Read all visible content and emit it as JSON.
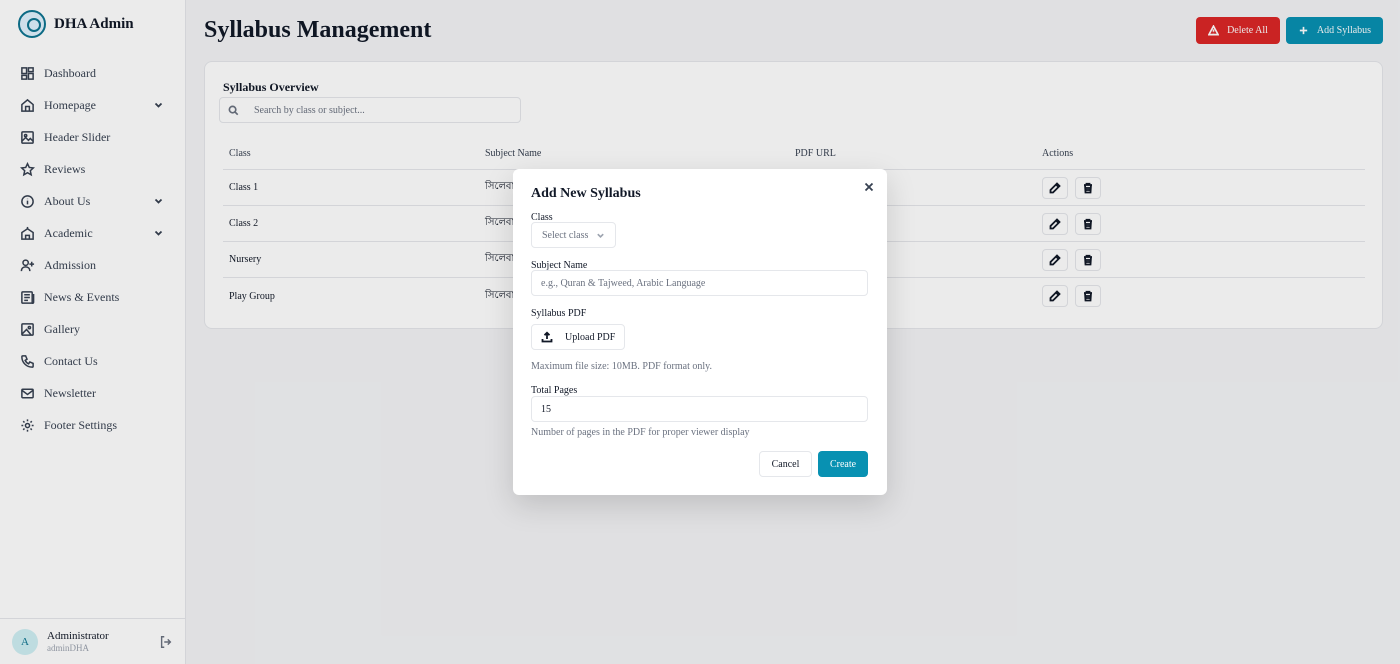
{
  "brand": {
    "name": "DHA Admin"
  },
  "sidebar": {
    "items": [
      {
        "label": "Dashboard",
        "icon": "dashboard-icon",
        "has_chevron": false
      },
      {
        "label": "Homepage",
        "icon": "home-icon",
        "has_chevron": true
      },
      {
        "label": "Header Slider",
        "icon": "image-icon",
        "has_chevron": false
      },
      {
        "label": "Reviews",
        "icon": "star-icon",
        "has_chevron": false
      },
      {
        "label": "About Us",
        "icon": "info-icon",
        "has_chevron": true
      },
      {
        "label": "Academic",
        "icon": "school-icon",
        "has_chevron": true
      },
      {
        "label": "Admission",
        "icon": "user-plus-icon",
        "has_chevron": false
      },
      {
        "label": "News & Events",
        "icon": "newspaper-icon",
        "has_chevron": false
      },
      {
        "label": "Gallery",
        "icon": "gallery-icon",
        "has_chevron": false
      },
      {
        "label": "Contact Us",
        "icon": "phone-icon",
        "has_chevron": false
      },
      {
        "label": "Newsletter",
        "icon": "mail-icon",
        "has_chevron": false
      },
      {
        "label": "Footer Settings",
        "icon": "gear-icon",
        "has_chevron": false
      }
    ]
  },
  "user": {
    "initial": "A",
    "name": "Administrator",
    "username": "adminDHA"
  },
  "page": {
    "title": "Syllabus Management",
    "delete_all_label": "Delete All",
    "add_label": "Add Syllabus"
  },
  "overview": {
    "title": "Syllabus Overview",
    "search_placeholder": "Search by class or subject...",
    "columns": [
      "Class",
      "Subject Name",
      "PDF URL",
      "Actions"
    ],
    "rows": [
      {
        "class": "Class 1",
        "subject": "সিলেবা"
      },
      {
        "class": "Class 2",
        "subject": "সিলেবা"
      },
      {
        "class": "Nursery",
        "subject": "সিলেবা"
      },
      {
        "class": "Play Group",
        "subject": "সিলেবা"
      }
    ]
  },
  "modal": {
    "title": "Add New Syllabus",
    "class_label": "Class",
    "class_placeholder": "Select class",
    "subject_label": "Subject Name",
    "subject_placeholder": "e.g., Quran & Tajweed, Arabic Language",
    "pdf_label": "Syllabus PDF",
    "upload_label": "Upload PDF",
    "pdf_hint": "Maximum file size: 10MB. PDF format only.",
    "pages_label": "Total Pages",
    "pages_value": "15",
    "pages_hint": "Number of pages in the PDF for proper viewer display",
    "cancel_label": "Cancel",
    "create_label": "Create"
  },
  "colors": {
    "primary": "#0891b2",
    "danger": "#dc2626"
  }
}
